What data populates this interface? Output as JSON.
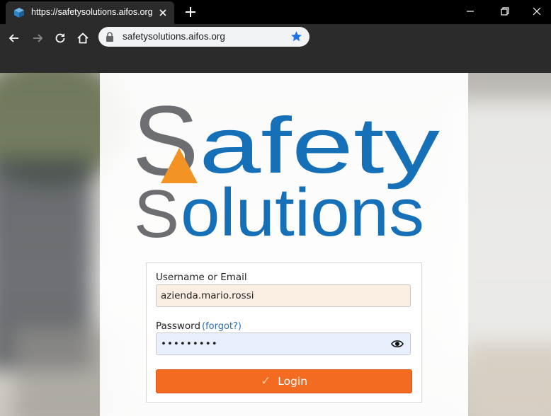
{
  "browser": {
    "tab_title": "https://safetysolutions.aifos.org",
    "url": "safetysolutions.aifos.org"
  },
  "logo": {
    "line1": "Safety",
    "line2": "Solutions",
    "colors": {
      "gray": "#6d6e71",
      "blue": "#1570b8",
      "orange": "#f29323"
    }
  },
  "login": {
    "username_label": "Username or Email",
    "username_value": "azienda.mario.rossi",
    "password_label": "Password",
    "forgot_label": "(forgot?)",
    "password_value": "•••••••••",
    "submit_label": "Login",
    "button_color": "#f26b21"
  }
}
